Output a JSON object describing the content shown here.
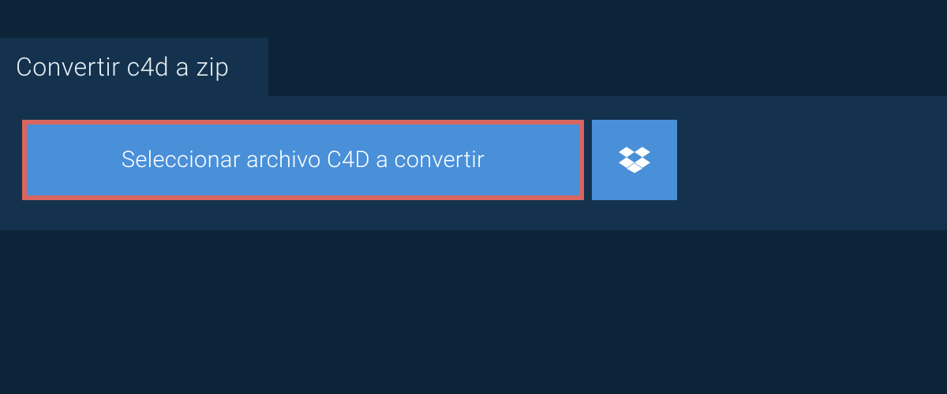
{
  "tab": {
    "title": "Convertir c4d a zip"
  },
  "actions": {
    "select_file_label": "Seleccionar archivo C4D a convertir"
  },
  "icons": {
    "dropbox": "dropbox-icon"
  },
  "colors": {
    "background": "#0d2438",
    "panel": "#14324d",
    "button": "#4a90d9",
    "highlight_border": "#d96560"
  }
}
